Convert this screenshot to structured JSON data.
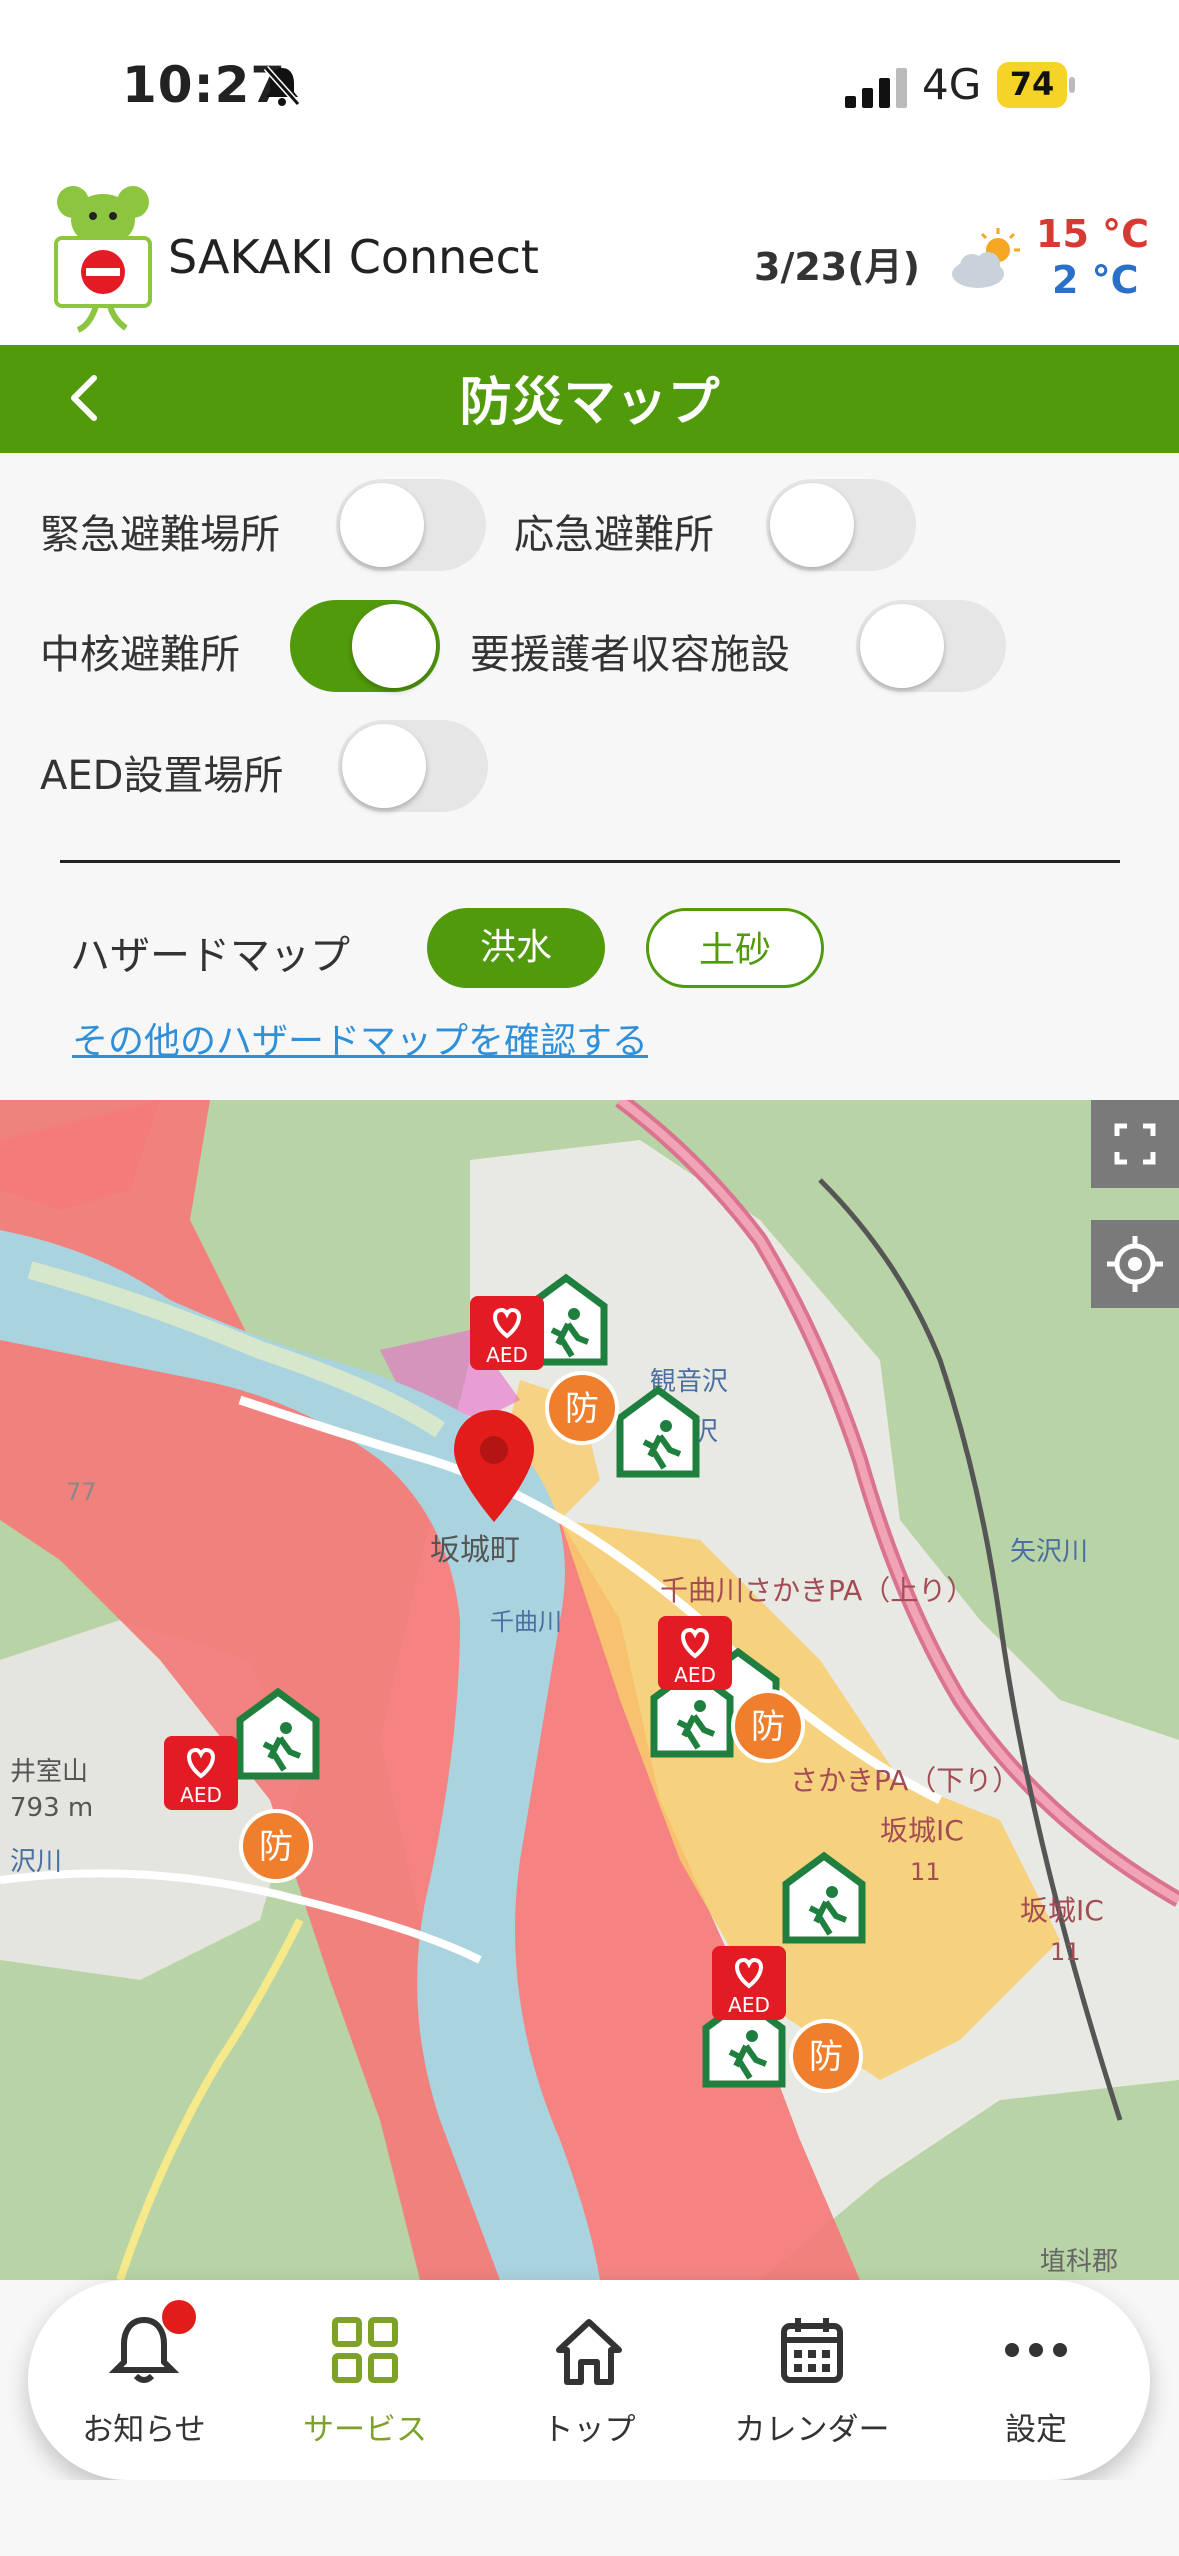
{
  "status": {
    "time": "10:27",
    "network": "4G",
    "battery": "74"
  },
  "header": {
    "app_name": "SAKAKI Connect",
    "date": "3/23(月)",
    "temp_high": "15 °C",
    "temp_low": "2 °C"
  },
  "titlebar": {
    "title": "防災マップ"
  },
  "filters": [
    {
      "label": "緊急避難場所",
      "on": false
    },
    {
      "label": "応急避難所",
      "on": false
    },
    {
      "label": "中核避難所",
      "on": true
    },
    {
      "label": "要援護者収容施設",
      "on": false
    },
    {
      "label": "AED設置場所",
      "on": false
    }
  ],
  "hazard": {
    "label": "ハザードマップ",
    "flood": "洪水",
    "landslide": "土砂",
    "link": "その他のハザードマップを確認する",
    "active": "洪水"
  },
  "map": {
    "aed_label": "AED",
    "bousai": "防",
    "labels": {
      "kannonsawa": "観音沢",
      "sakasotozawa": "坂外沢",
      "sakaki_town": "坂城町",
      "chikumagawa": "千曲川",
      "pa_up": "千曲川さかきPA（上り）",
      "pa_down": "さかきPA（下り）",
      "ic1": "坂城IC",
      "ic2": "坂城IC",
      "ic_no": "11",
      "mountain": "井室山",
      "elev": "793 m",
      "river_w": "沢川",
      "meisawa": "矢沢川",
      "num77": "77",
      "oniwa": "埴科郡"
    }
  },
  "nav": [
    {
      "label": "お知らせ",
      "icon": "bell-icon"
    },
    {
      "label": "サービス",
      "icon": "grid-icon",
      "active": true
    },
    {
      "label": "トップ",
      "icon": "home-icon"
    },
    {
      "label": "カレンダー",
      "icon": "calendar-icon"
    },
    {
      "label": "設定",
      "icon": "more-icon"
    }
  ],
  "colors": {
    "brand_green": "#519a0b",
    "flood_red": "#f47a7a",
    "aed_red": "#e21b24",
    "shelter_green": "#1f7f3f",
    "bousai_orange": "#ef7f2d"
  }
}
